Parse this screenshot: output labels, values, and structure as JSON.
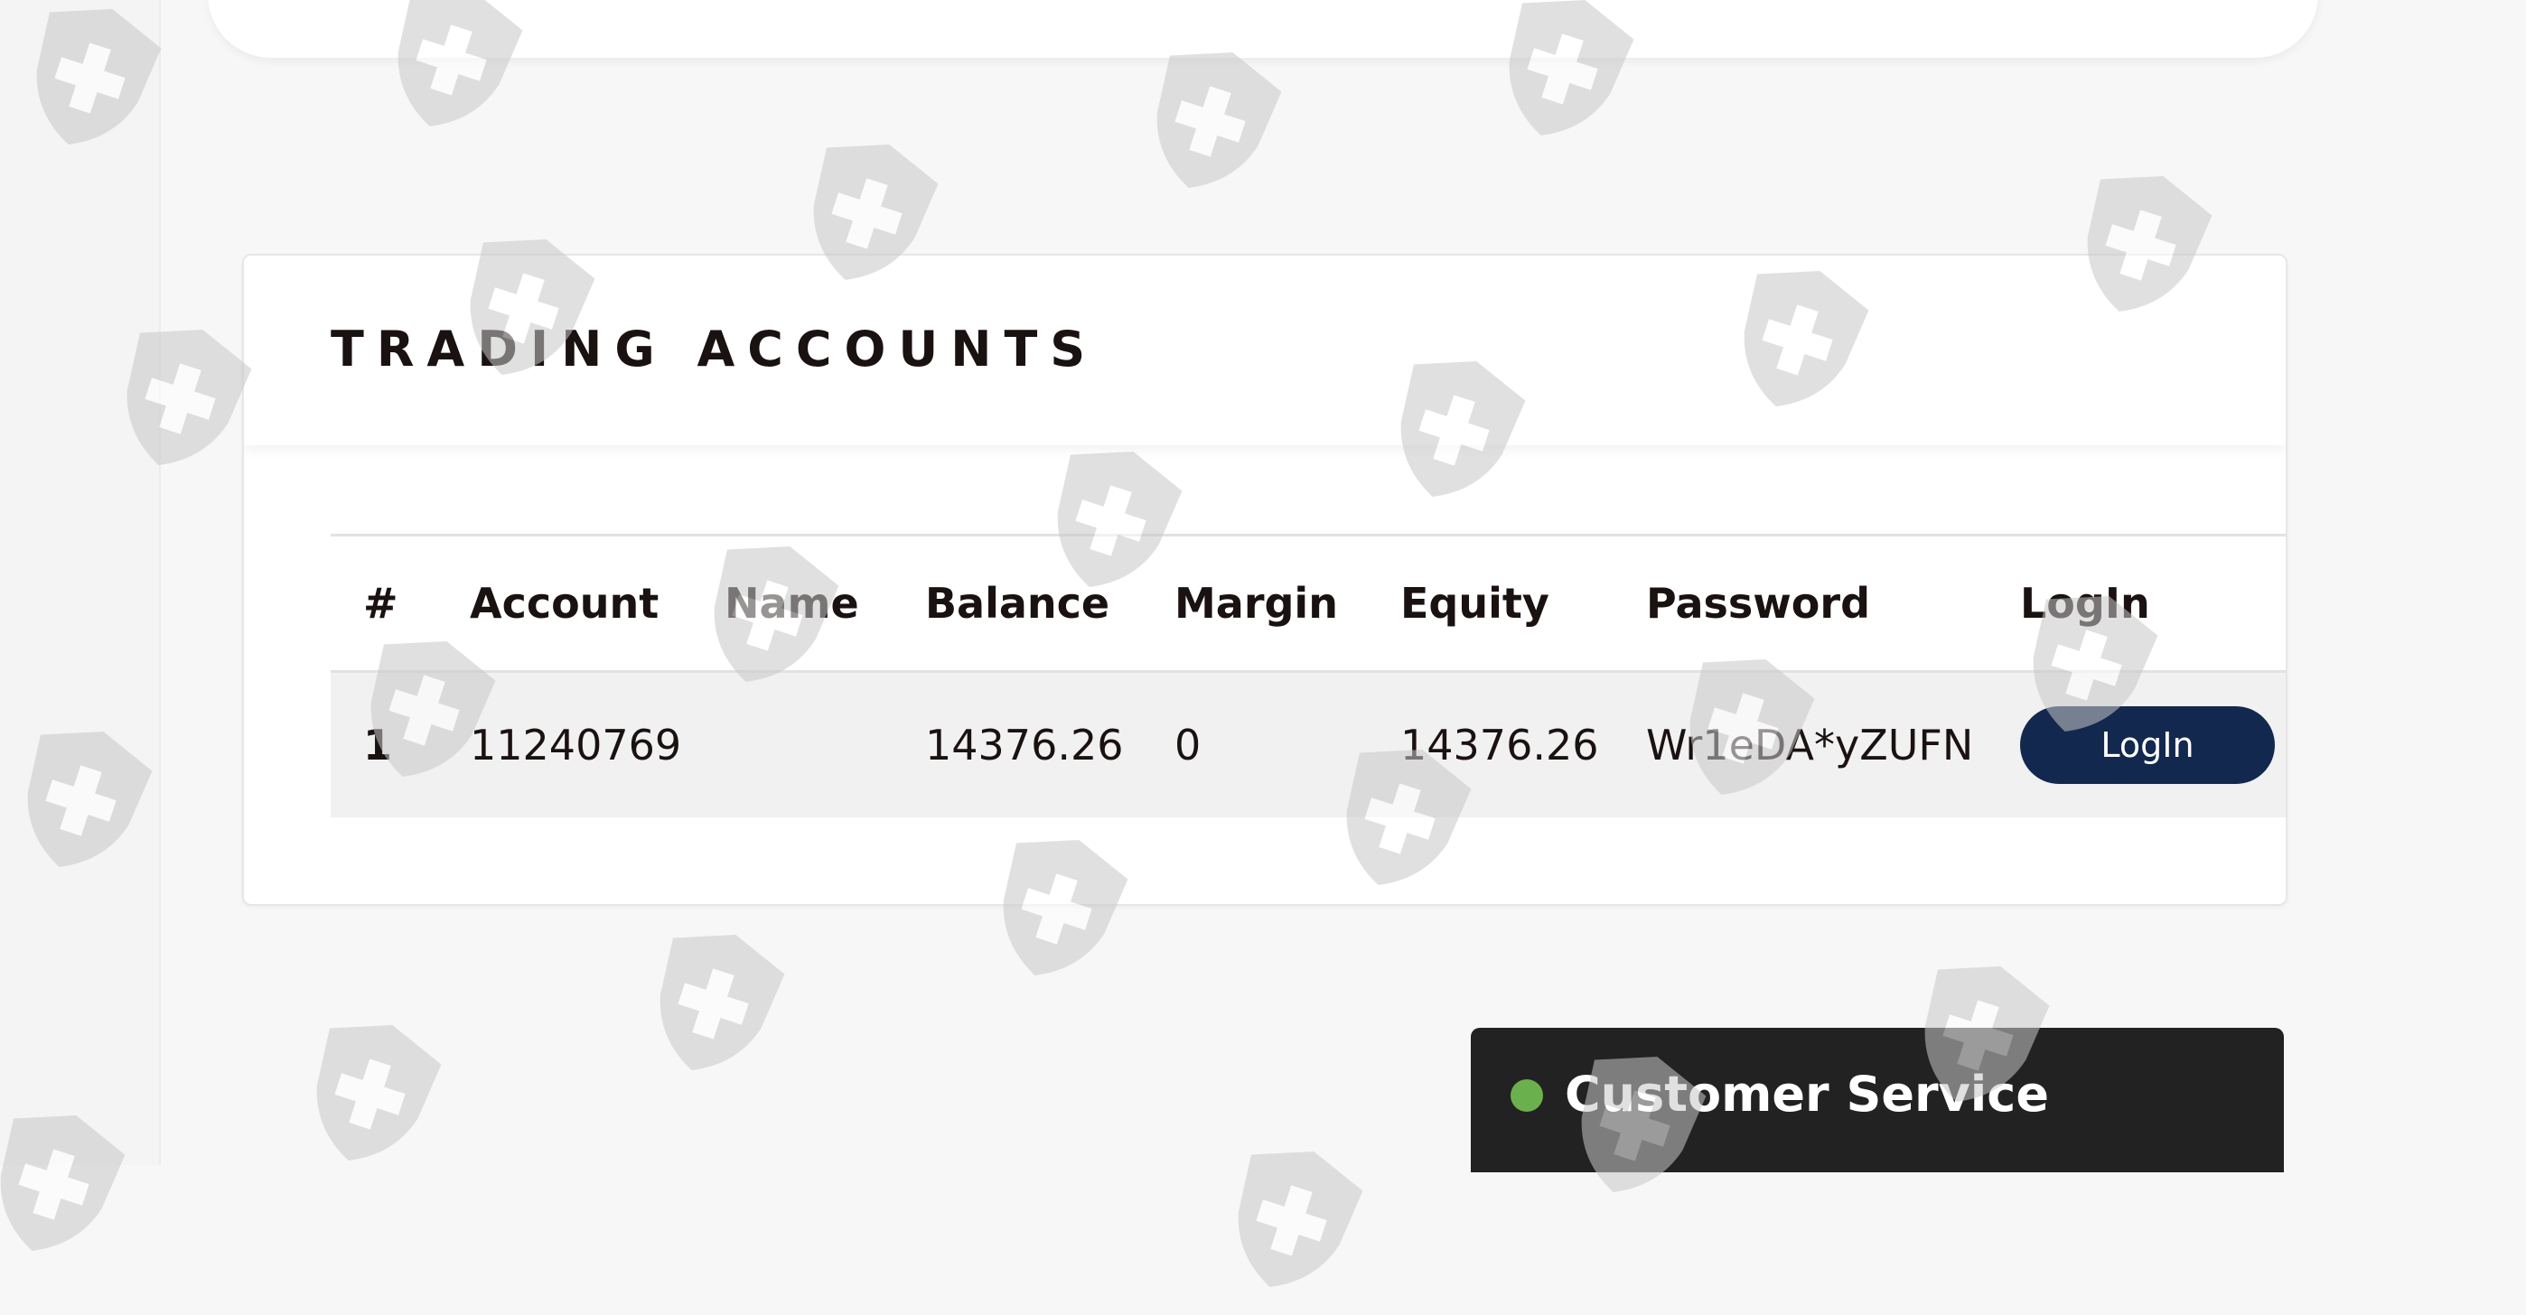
{
  "accounts": {
    "title": "TRADING ACCOUNTS",
    "columns": [
      "#",
      "Account",
      "Name",
      "Balance",
      "Margin",
      "Equity",
      "Password",
      "LogIn"
    ],
    "rows": [
      {
        "index": "1",
        "account": "11240769",
        "name": "",
        "balance": "14376.26",
        "margin": "0",
        "equity": "14376.26",
        "password": "Wr1eDA*yZUFN",
        "login_label": "LogIn"
      }
    ]
  },
  "customer_service": {
    "label": "Customer Service",
    "status": "online",
    "status_color": "#6ab04c"
  },
  "colors": {
    "login_button": "#13284f",
    "watermark": "#c8c8c8"
  },
  "icons": {
    "watermark": "shield-cross-icon"
  }
}
